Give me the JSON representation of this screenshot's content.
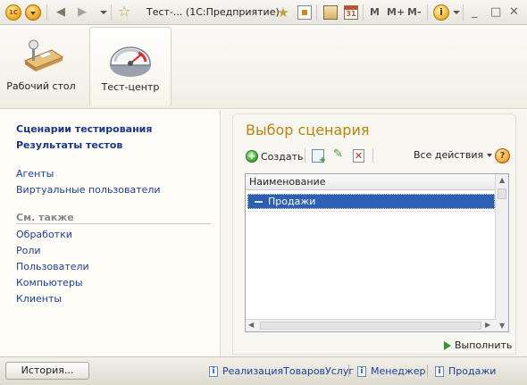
{
  "window": {
    "title": "Тест-... (1С:Предприятие)",
    "logo_text": "1С",
    "m_buttons": [
      "M",
      "M+",
      "M-"
    ],
    "calendar_day": "31",
    "info_label": "i",
    "minimize": "_",
    "maximize": "□",
    "close": "✕"
  },
  "sections": [
    {
      "label": "Рабочий стол",
      "icon": "desktop-icon"
    },
    {
      "label": "Тест-центр",
      "icon": "gauge-icon",
      "active": true
    }
  ],
  "left_panel": {
    "primary": [
      "Сценарии тестирования",
      "Результаты тестов"
    ],
    "secondary": [
      "Агенты",
      "Виртуальные пользователи"
    ],
    "see_also_heading": "См. также",
    "see_also": [
      "Обработки",
      "Роли",
      "Пользователи",
      "Компьютеры",
      "Клиенты"
    ]
  },
  "form": {
    "title": "Выбор сценария",
    "toolbar": {
      "create_label": "Создать",
      "create_symbol": "+",
      "all_actions_label": "Все действия",
      "help_label": "?",
      "edit_symbol": "✎",
      "delete_symbol": "✕"
    },
    "grid": {
      "column_header": "Наименование",
      "rows": [
        {
          "name": "Продажи",
          "selected": true
        }
      ]
    },
    "execute_label": "Выполнить"
  },
  "statusbar": {
    "history_label": "История...",
    "history_links": [
      "РеализацияТоваровУслуг",
      "Менеджер",
      "Продажи"
    ],
    "link_icon_label": "i"
  }
}
